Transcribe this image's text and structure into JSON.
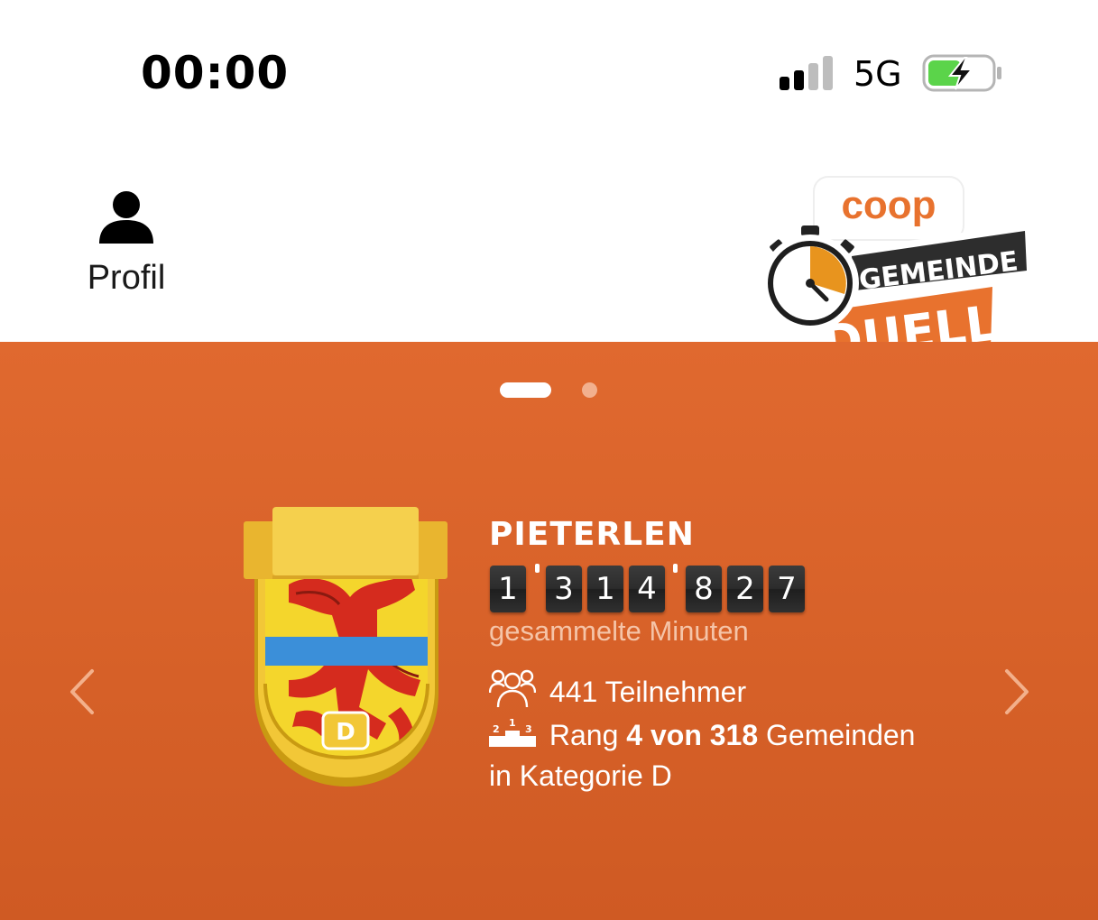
{
  "status_bar": {
    "time": "00:00",
    "network": "5G",
    "signal_bars_active": 2,
    "signal_bars_total": 4,
    "battery_charging": true
  },
  "header": {
    "profile_label": "Profil",
    "logo": {
      "brand": "coop",
      "line1": "GEMEINDE",
      "line2": "DUELL"
    }
  },
  "carousel": {
    "page_count": 2,
    "active_index": 0
  },
  "municipality": {
    "name": "PIETERLEN",
    "minutes_digits": [
      "1",
      "3",
      "1",
      "4",
      "8",
      "2",
      "7"
    ],
    "minutes_caption": "gesammelte Minuten",
    "category_badge": "D",
    "participants_count": "441",
    "participants_label": "Teilnehmer",
    "rank_prefix": "Rang",
    "rank_value": "4 von 318",
    "rank_suffix": "Gemeinden",
    "category_line": "in Kategorie D"
  },
  "colors": {
    "accent_orange": "#dd652b",
    "logo_orange": "#e8722e",
    "battery_green": "#5bd44a",
    "badge_yellow": "#f2c737"
  },
  "icons": {
    "profile": "person-icon",
    "participants": "people-group-icon",
    "rank": "podium-icon",
    "prev": "chevron-left-icon",
    "next": "chevron-right-icon"
  }
}
